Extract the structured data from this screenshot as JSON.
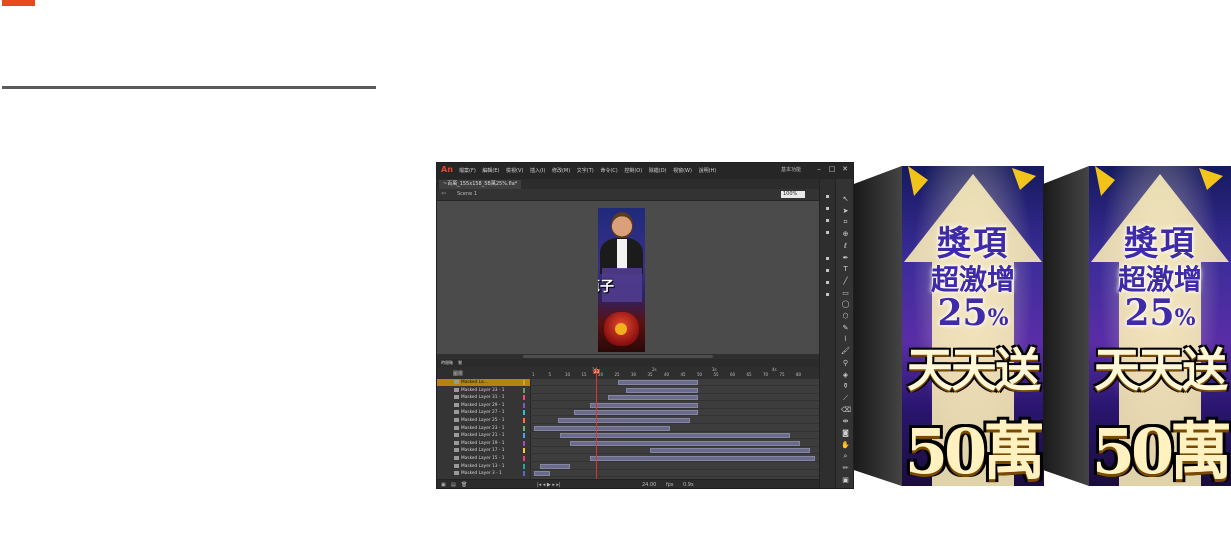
{
  "app": {
    "logo": "An",
    "menu": [
      "檔案(F)",
      "編輯(E)",
      "檢視(V)",
      "插入(I)",
      "修改(M)",
      "文字(T)",
      "命令(C)",
      "控制(O)",
      "除錯(D)",
      "視窗(W)",
      "說明(H)"
    ],
    "workspace": "基本功能",
    "document_tab": "~百萬_155x158_5B萬25%.fla*",
    "scene": "Scene 1",
    "zoom": "100%",
    "canvas_text": "芭子",
    "timeline": {
      "tabs": [
        "時間軸",
        "動"
      ],
      "layer_header": "圖層",
      "ruler_seconds": [
        "1s",
        "2s",
        "3s",
        "4s"
      ],
      "ruler_frames": [
        "1",
        "5",
        "10",
        "15",
        "20",
        "25",
        "30",
        "35",
        "40",
        "45",
        "50",
        "55",
        "60",
        "65",
        "70",
        "75",
        "80"
      ],
      "playhead_frame": "23",
      "layers": [
        {
          "name": "Masked La...",
          "selected": true,
          "swatch": "#e0a020"
        },
        {
          "name": "Masked Layer 33 - 1",
          "selected": false,
          "swatch": "#4caf50"
        },
        {
          "name": "Masked Layer 31 - 1",
          "selected": false,
          "swatch": "#ff4081"
        },
        {
          "name": "Masked Layer 29 - 1",
          "selected": false,
          "swatch": "#7e57c2"
        },
        {
          "name": "Masked Layer 27 - 1",
          "selected": false,
          "swatch": "#26c6da"
        },
        {
          "name": "Masked Layer 25 - 1",
          "selected": false,
          "swatch": "#ff7043"
        },
        {
          "name": "Masked Layer 23 - 1",
          "selected": false,
          "swatch": "#66bb6a"
        },
        {
          "name": "Masked Layer 21 - 1",
          "selected": false,
          "swatch": "#42a5f5"
        },
        {
          "name": "Masked Layer 19 - 1",
          "selected": false,
          "swatch": "#ab47bc"
        },
        {
          "name": "Masked Layer 17 - 1",
          "selected": false,
          "swatch": "#ffca28"
        },
        {
          "name": "Masked Layer 15 - 1",
          "selected": false,
          "swatch": "#ec407a"
        },
        {
          "name": "Masked Layer 13 - 1",
          "selected": false,
          "swatch": "#26a69a"
        },
        {
          "name": "Masked Layer 3 - 1",
          "selected": false,
          "swatch": "#5c6bc0"
        }
      ],
      "footer_fps": "24.00",
      "footer_fps_unit": "fps",
      "footer_time": "0.9s"
    }
  },
  "banner": {
    "line1": "獎項",
    "line2": "超激增",
    "line3_num": "25",
    "line3_unit": "%",
    "line4": "天天送",
    "line5": "50萬"
  },
  "colors": {
    "accent": "#e84a1c",
    "rule": "#5b5b5b",
    "banner_text": "#3f2aa8"
  }
}
